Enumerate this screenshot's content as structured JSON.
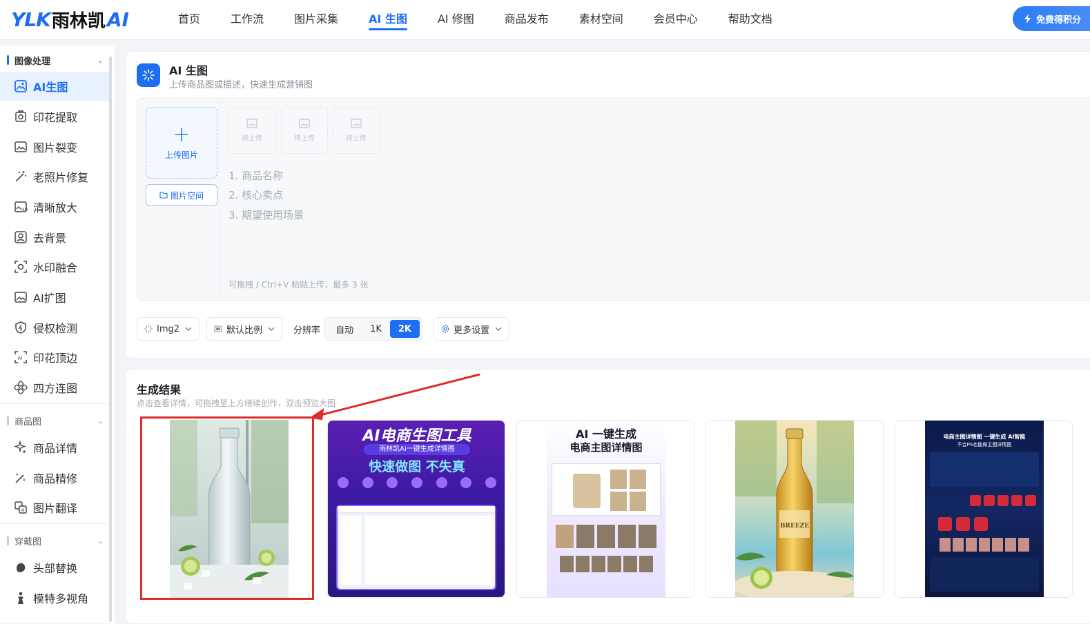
{
  "brand": {
    "ylk": "YLK",
    "cn": "雨林凯",
    "ai": "AI"
  },
  "nav": [
    {
      "label": "首页",
      "active": false
    },
    {
      "label": "工作流",
      "active": false
    },
    {
      "label": "图片采集",
      "active": false
    },
    {
      "label": "AI 生图",
      "active": true
    },
    {
      "label": "AI 修图",
      "active": false
    },
    {
      "label": "商品发布",
      "active": false
    },
    {
      "label": "素材空间",
      "active": false
    },
    {
      "label": "会员中心",
      "active": false
    },
    {
      "label": "帮助文档",
      "active": false
    }
  ],
  "cta": {
    "label": "免费得积分"
  },
  "sidebar": {
    "groups": [
      {
        "label": "图像处理",
        "icon": "chevron-down-icon"
      },
      {
        "label": "商品图",
        "icon": "chevron-down-icon"
      },
      {
        "label": "穿戴图",
        "icon": "chevron-down-icon"
      }
    ],
    "items": [
      {
        "label": "AI生图",
        "icon": "ai-image-icon",
        "active": true
      },
      {
        "label": "印花提取",
        "icon": "print-extract-icon"
      },
      {
        "label": "图片裂变",
        "icon": "image-variant-icon"
      },
      {
        "label": "老照片修复",
        "icon": "magic-wand-icon"
      },
      {
        "label": "清晰放大",
        "icon": "upscale-icon"
      },
      {
        "label": "去背景",
        "icon": "remove-bg-icon"
      },
      {
        "label": "水印融合",
        "icon": "watermark-icon"
      },
      {
        "label": "AI扩图",
        "icon": "expand-image-icon"
      },
      {
        "label": "侵权检测",
        "icon": "shield-icon"
      },
      {
        "label": "印花顶边",
        "icon": "frame-icon"
      },
      {
        "label": "四方连图",
        "icon": "pattern-icon"
      },
      {
        "label": "商品详情",
        "icon": "sparkle-icon"
      },
      {
        "label": "商品精修",
        "icon": "retouch-icon"
      },
      {
        "label": "图片翻译",
        "icon": "translate-icon"
      },
      {
        "label": "头部替换",
        "icon": "head-swap-icon"
      },
      {
        "label": "模特多视角",
        "icon": "model-view-icon"
      }
    ]
  },
  "panel": {
    "title": "AI 生图",
    "subtitle": "上传商品图或描述，快速生成营销图",
    "upload_label": "上传图片",
    "space_label": "图片空间",
    "slot_label": "待上传",
    "hints": [
      "1. 商品名称",
      "2. 核心卖点",
      "3. 期望使用场景"
    ],
    "footer_hint": "可拖拽 / Ctrl+V 粘贴上传，最多 3 张"
  },
  "toolbar": {
    "model": "Img2",
    "ratio": "默认比例",
    "resolution_label": "分辨率",
    "resolution_options": [
      "自动",
      "1K",
      "2K"
    ],
    "resolution_selected": "2K",
    "more": "更多设置"
  },
  "results": {
    "title": "生成结果",
    "subtitle": "点击查看详情，可拖拽至上方继续创作，双击预览大图",
    "thumbs": [
      {
        "name": "sparkling-water-bottle",
        "selected": true
      },
      {
        "name": "ai-ecommerce-tool-poster",
        "title": "AI电商生图工具",
        "line2": "雨林凯Ai一键生成详情图",
        "line3": "快速做图 不失真"
      },
      {
        "name": "main-detail-image-poster",
        "title": "AI 一键生成",
        "line2": "电商主图详情图"
      },
      {
        "name": "breeze-bottle",
        "label": "BREEZE"
      },
      {
        "name": "dark-detail-page-poster",
        "title": "电商主图详情图 一键生成 AI智能",
        "line2": "不会PS也能做主图详情图"
      }
    ]
  },
  "colors": {
    "accent": "#1d6ef2",
    "highlight": "#e02b2b"
  }
}
